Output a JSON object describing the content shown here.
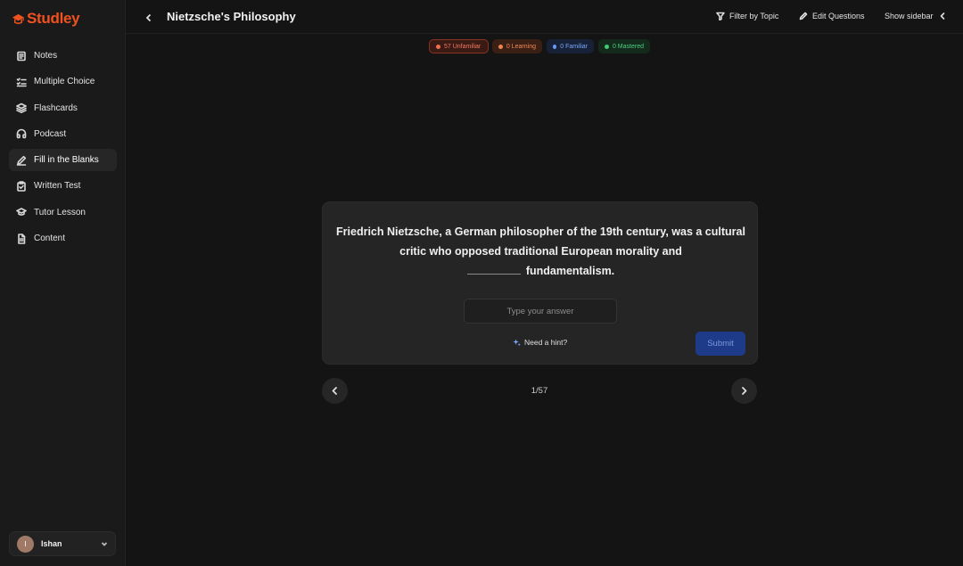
{
  "app": {
    "name": "Studley",
    "brand_color": "#f0521f"
  },
  "sidebar": {
    "items": [
      {
        "label": "Notes",
        "icon": "notes-icon"
      },
      {
        "label": "Multiple Choice",
        "icon": "list-check-icon"
      },
      {
        "label": "Flashcards",
        "icon": "layers-icon"
      },
      {
        "label": "Podcast",
        "icon": "headphones-icon"
      },
      {
        "label": "Fill in the Blanks",
        "icon": "pencil-icon",
        "active": true
      },
      {
        "label": "Written Test",
        "icon": "clipboard-check-icon"
      },
      {
        "label": "Tutor Lesson",
        "icon": "graduation-cap-icon"
      },
      {
        "label": "Content",
        "icon": "document-icon"
      }
    ],
    "user": {
      "initial": "I",
      "name": "Ishan"
    }
  },
  "header": {
    "title": "Nietzsche's Philosophy",
    "filter_label": "Filter by Topic",
    "edit_label": "Edit Questions",
    "sidebar_label": "Show sidebar"
  },
  "status": {
    "unfamiliar": "57 Unfamiliar",
    "learning": "0 Learning",
    "familiar": "0 Familiar",
    "mastered": "0 Mastered"
  },
  "card": {
    "question_before": "Friedrich Nietzsche, a German philosopher of the 19th century, was a cultural critic who opposed traditional European morality and",
    "question_after": "fundamentalism.",
    "answer_placeholder": "Type your answer",
    "hint_label": "Need a hint?",
    "submit_label": "Submit"
  },
  "pagination": {
    "counter": "1/57"
  }
}
